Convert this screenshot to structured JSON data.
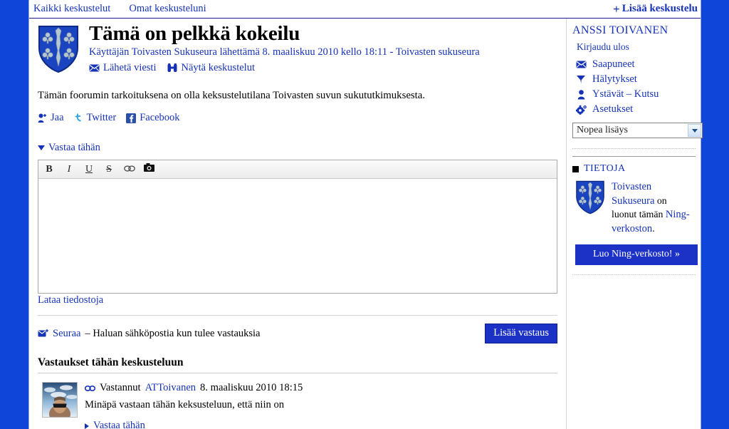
{
  "topnav": {
    "all_discussions": "Kaikki keskustelut",
    "my_discussions": "Omat keskusteluni",
    "add_discussion": "Lisää keskustelu",
    "plus": "+"
  },
  "discussion": {
    "title": "Tämä on pelkkä kokeilu",
    "byline_prefix": "Käyttäjän",
    "author": "Toivasten Sukuseura",
    "byline_middle": "lähettämä 8. maaliskuu 2010 kello 18:11 -",
    "group": "Toivasten sukuseura",
    "send_message": "Lähetä viesti",
    "view_discussions": "Näytä keskustelut",
    "body": "Tämän foorumin tarkoituksena on olla keksustelutilana Toivasten suvun sukututkimuksesta."
  },
  "share": {
    "share_label": "Jaa",
    "twitter_label": "Twitter",
    "facebook_label": "Facebook"
  },
  "reply_form": {
    "toggle_label": "Vastaa tähän",
    "toolbar": {
      "bold": "B",
      "italic": "I",
      "underline": "U",
      "strike": "S",
      "link": "∞",
      "image": "▣"
    },
    "editor_value": "",
    "upload_link": "Lataa tiedostoja",
    "follow_label": "Seuraa",
    "follow_text": "– Haluan sähköpostia kun tulee vastauksia",
    "submit_label": "Lisää vastaus"
  },
  "replies": {
    "heading": "Vastaukset tähän keskusteluun",
    "items": [
      {
        "verb": "Vastannut",
        "author": "ATToivanen",
        "timestamp": "8. maaliskuu 2010 18:15",
        "text": "Minäpä vastaan tähän keksusteluun, että niin on",
        "reply_link": "Vastaa tähän"
      }
    ]
  },
  "sidebar": {
    "username": "ANSSI TOIVANEN",
    "logout": "Kirjaudu ulos",
    "items": [
      {
        "label": "Saapuneet",
        "icon": "envelope-icon"
      },
      {
        "label": "Hälytykset",
        "icon": "flag-icon"
      },
      {
        "label": "Ystävät – Kutsu",
        "icon": "person-icon"
      },
      {
        "label": "Asetukset",
        "icon": "gear-icon"
      }
    ],
    "quick_add": {
      "selected": "Nopea lisäys"
    },
    "info": {
      "heading": "TIETOJA",
      "creator": "Toivasten Sukuseura",
      "text_middle": " on luonut tämän ",
      "network": "Ning-verkoston",
      "text_end": ".",
      "cta": "Luo Ning-verkosto! »"
    }
  },
  "colors": {
    "page_background": "#0b3bc4",
    "link": "#1633b8",
    "button": "#1c32c6",
    "crest_blue": "#1a44c0",
    "crest_silver": "#adc0cc"
  }
}
